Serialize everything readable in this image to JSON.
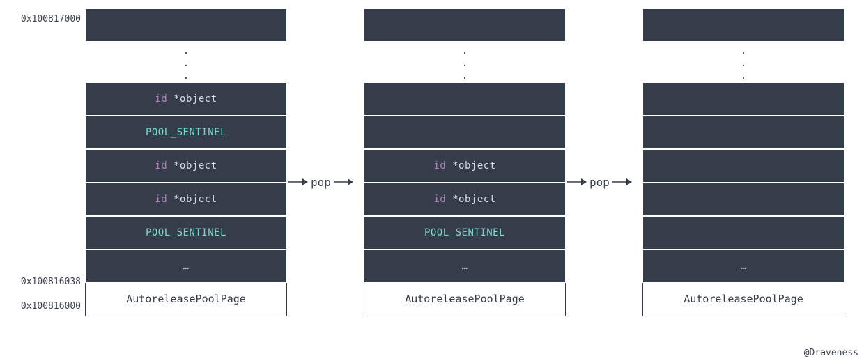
{
  "addresses": {
    "top": "0x100817000",
    "meta": "0x100816038",
    "base": "0x100816000"
  },
  "op": "pop",
  "credit": "@Draveness",
  "footer": "AutoreleasePoolPage",
  "ellipsis": "…",
  "text": {
    "id_kw": "id",
    "obj": " *object",
    "sentinel": "POOL_SENTINEL"
  },
  "columns": [
    {
      "name": "before",
      "rows": [
        {
          "kind": "empty"
        },
        {
          "kind": "dots"
        },
        {
          "kind": "obj"
        },
        {
          "kind": "sentinel"
        },
        {
          "kind": "obj"
        },
        {
          "kind": "obj"
        },
        {
          "kind": "sentinel"
        },
        {
          "kind": "ellipsis"
        }
      ]
    },
    {
      "name": "after-one-pop",
      "rows": [
        {
          "kind": "empty"
        },
        {
          "kind": "dots"
        },
        {
          "kind": "empty"
        },
        {
          "kind": "empty"
        },
        {
          "kind": "obj"
        },
        {
          "kind": "obj"
        },
        {
          "kind": "sentinel"
        },
        {
          "kind": "ellipsis"
        }
      ]
    },
    {
      "name": "after-two-pops",
      "rows": [
        {
          "kind": "empty"
        },
        {
          "kind": "dots"
        },
        {
          "kind": "empty"
        },
        {
          "kind": "empty"
        },
        {
          "kind": "empty"
        },
        {
          "kind": "empty"
        },
        {
          "kind": "empty"
        },
        {
          "kind": "ellipsis"
        }
      ]
    }
  ]
}
